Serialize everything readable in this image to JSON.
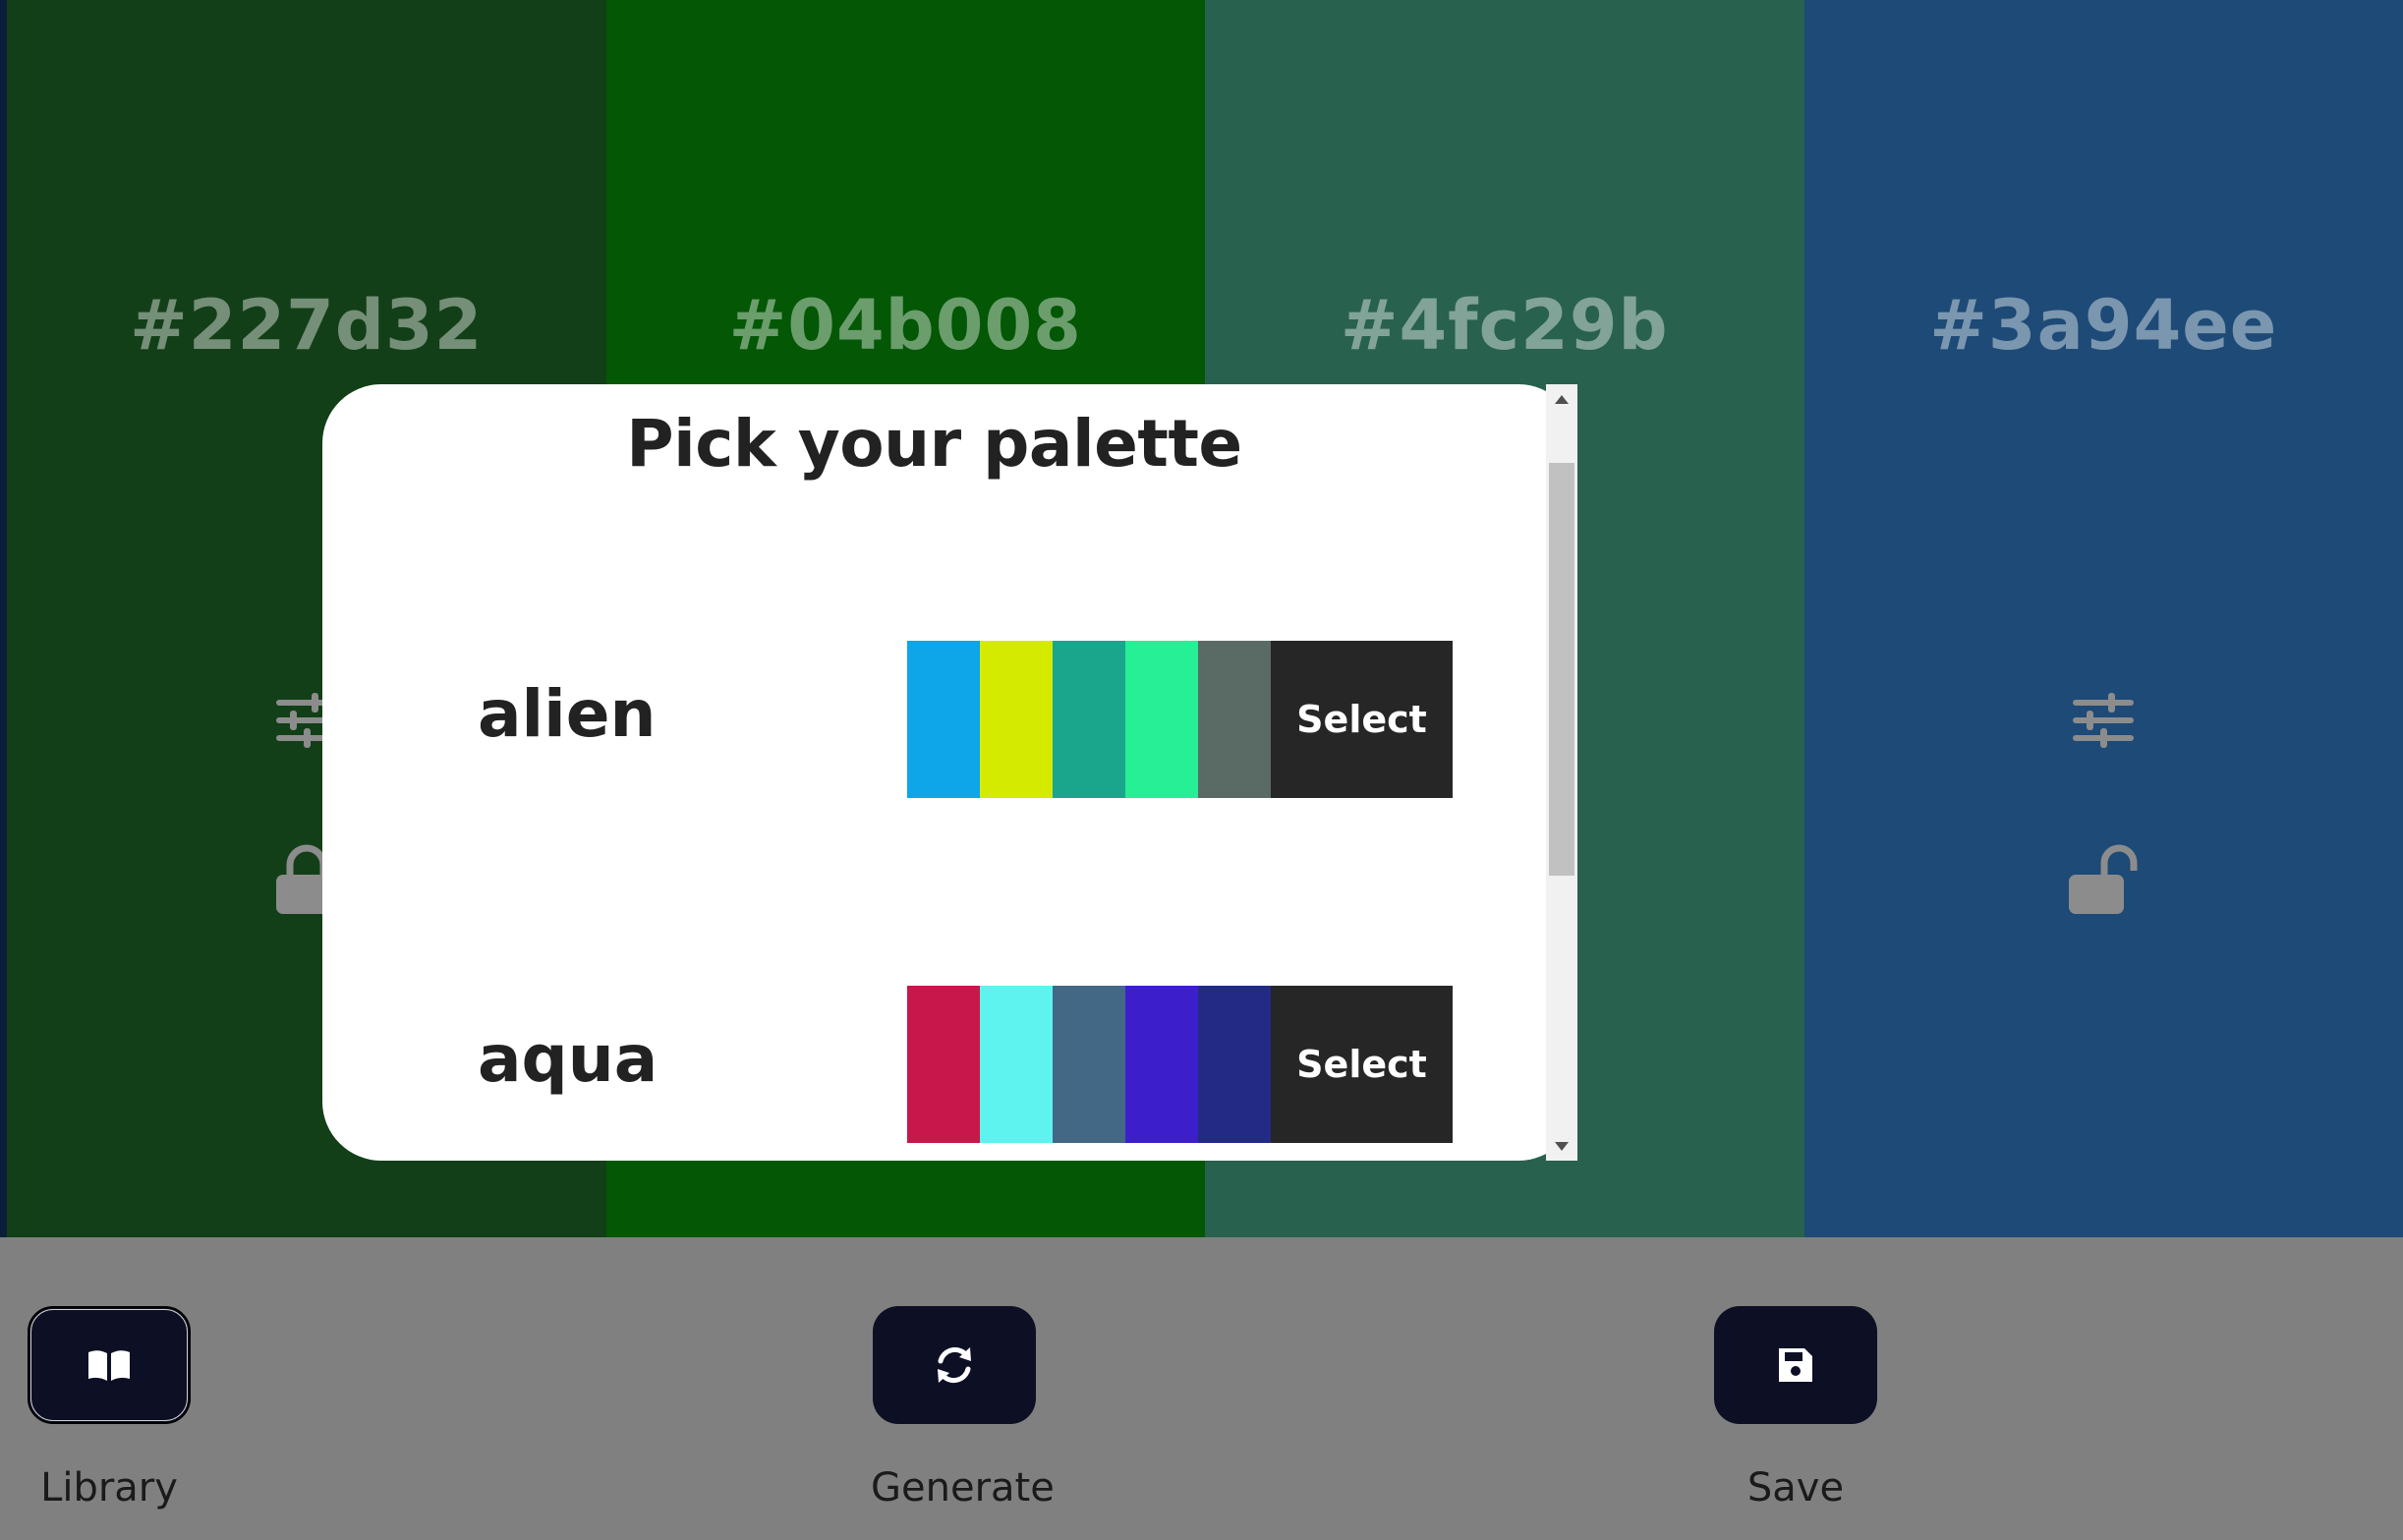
{
  "columns": [
    {
      "hex": "#227d32",
      "bg": "#123f18",
      "lock_icon": "lock-icon"
    },
    {
      "hex": "#04b008",
      "bg": "#035705",
      "lock_icon": "lock-icon"
    },
    {
      "hex": "#4fc29b",
      "bg": "#28614d",
      "lock_icon": "unlock-icon"
    },
    {
      "hex": "#3a94ee",
      "bg": "#1d4a76",
      "lock_icon": "unlock-icon"
    }
  ],
  "modal": {
    "title": "Pick your palette",
    "palettes": [
      {
        "name": "alien",
        "colors": [
          "#0ea5e9",
          "#d4ea00",
          "#1aa68c",
          "#27ef96",
          "#5a6b66"
        ],
        "select_label": "Select"
      },
      {
        "name": "aqua",
        "colors": [
          "#c8174a",
          "#5ef3ee",
          "#426886",
          "#3d1ecb",
          "#232a86"
        ],
        "select_label": "Select"
      }
    ]
  },
  "actions": {
    "library": {
      "label": "Library",
      "icon": "book-icon"
    },
    "generate": {
      "label": "Generate",
      "icon": "refresh-icon"
    },
    "save": {
      "label": "Save",
      "icon": "floppy-disk-icon"
    }
  },
  "colors": {
    "icon_gray": "#8c8c8c",
    "bottom_bar": "#808080",
    "button_dark": "#0d1024",
    "select_bg": "#262626"
  }
}
